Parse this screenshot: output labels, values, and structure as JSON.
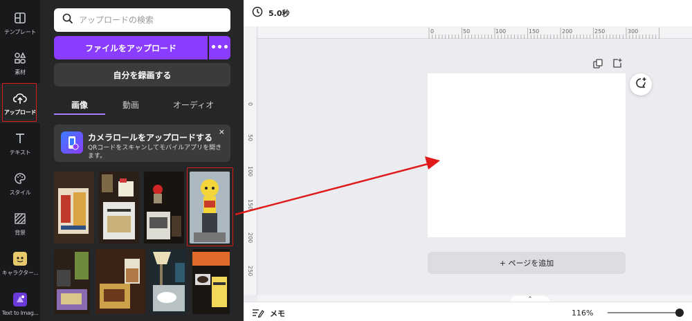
{
  "sidebar": {
    "items": [
      {
        "label": "テンプレート",
        "icon": "template-icon"
      },
      {
        "label": "素材",
        "icon": "elements-icon"
      },
      {
        "label": "アップロード",
        "icon": "cloud-upload-icon"
      },
      {
        "label": "テキスト",
        "icon": "text-icon"
      },
      {
        "label": "スタイル",
        "icon": "palette-icon"
      },
      {
        "label": "背景",
        "icon": "background-icon"
      },
      {
        "label": "キャラクター...",
        "icon": "character-icon"
      },
      {
        "label": "Text to Imag...",
        "icon": "text-to-image-icon"
      }
    ]
  },
  "panel": {
    "search_placeholder": "アップロードの検索",
    "upload_button": "ファイルをアップロード",
    "more_button": "•••",
    "record_button": "自分を録画する",
    "tabs": [
      "画像",
      "動画",
      "オーディオ"
    ],
    "promo": {
      "title": "カメラロールをアップロードする",
      "text": "QRコードをスキャンしてモバイルアプリを開きます。",
      "close": "×"
    }
  },
  "topbar": {
    "timer": "5.0秒"
  },
  "ruler": {
    "h_labels": [
      "0",
      "50",
      "100",
      "150",
      "200",
      "250",
      "300"
    ],
    "v_labels": [
      "0",
      "50",
      "100",
      "150",
      "200",
      "250"
    ]
  },
  "canvas": {
    "add_page": "+ ページを追加"
  },
  "bottombar": {
    "memo": "メモ",
    "zoom": "116%",
    "zoom_level": 1.0
  },
  "colors": {
    "accent": "#8b3dff",
    "annotation": "#e01b1b"
  }
}
